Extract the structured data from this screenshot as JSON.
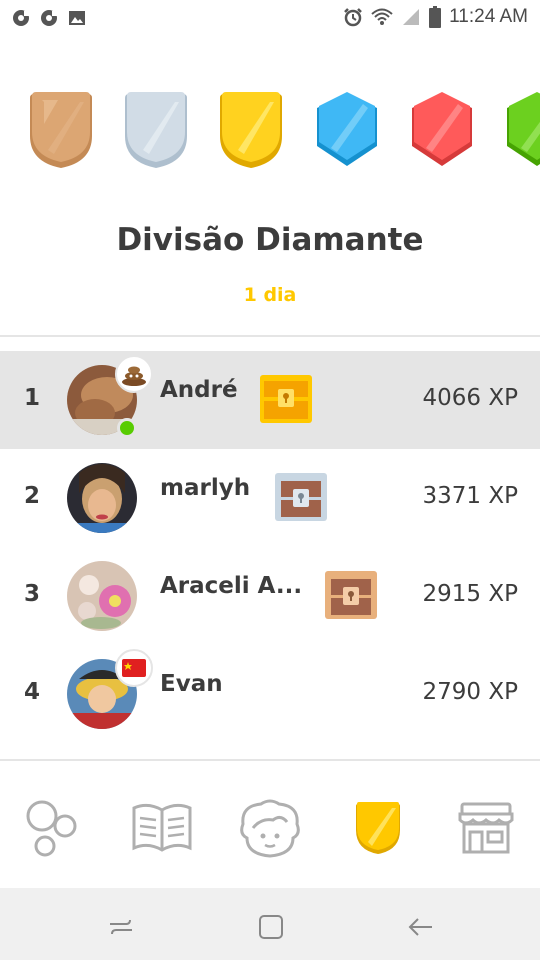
{
  "status_bar": {
    "time": "11:24 AM",
    "left_icons": [
      "notification-icon",
      "notification-icon",
      "image-icon"
    ],
    "right_icons": [
      "alarm-icon",
      "wifi-icon",
      "signal-icon",
      "battery-icon"
    ]
  },
  "leagues": {
    "badges": [
      {
        "name": "bronze-league-icon",
        "color": "#d9a066"
      },
      {
        "name": "silver-league-icon",
        "color": "#c8d4e0"
      },
      {
        "name": "gold-league-icon",
        "color": "#ffc800"
      },
      {
        "name": "sapphire-league-icon",
        "color": "#1cb0f6"
      },
      {
        "name": "ruby-league-icon",
        "color": "#ff4b4b"
      },
      {
        "name": "emerald-league-icon",
        "color": "#58cc02"
      }
    ],
    "title": "Divisão Diamante",
    "time_left": "1 dia"
  },
  "leaderboard": {
    "rows": [
      {
        "rank": "1",
        "name": "André",
        "xp": "4066 XP",
        "chest": "gold",
        "highlight": true
      },
      {
        "rank": "2",
        "name": "marlyh",
        "xp": "3371 XP",
        "chest": "silver"
      },
      {
        "rank": "3",
        "name": "Araceli A...",
        "xp": "2915 XP",
        "chest": "bronze"
      },
      {
        "rank": "4",
        "name": "Evan",
        "xp": "2790 XP"
      }
    ]
  },
  "bottom_nav": {
    "items": [
      "lessons-icon",
      "stories-icon",
      "profile-icon",
      "leagues-icon",
      "shop-icon"
    ],
    "active": "leagues-icon"
  },
  "colors": {
    "accent_gold": "#ffc800",
    "text": "#3c3c3c",
    "highlight_row": "#e5e5e5",
    "online": "#58cc02"
  }
}
